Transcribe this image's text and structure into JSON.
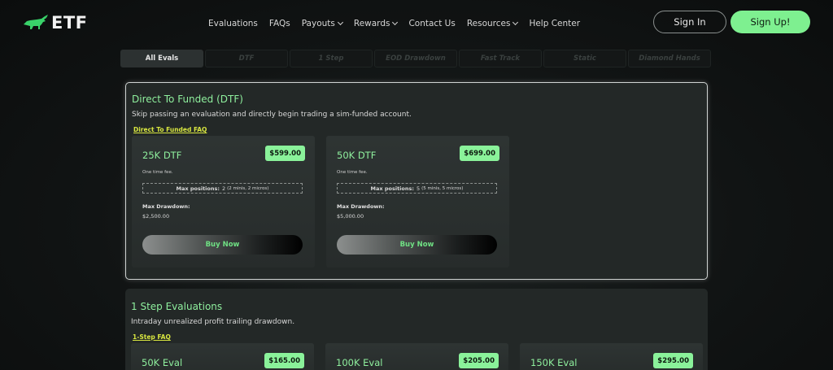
{
  "brand": {
    "logo_text": "ETF",
    "accent": "#8ff09e",
    "bull_color": "#39d36a"
  },
  "nav": [
    {
      "label": "Evaluations",
      "dropdown": false
    },
    {
      "label": "FAQs",
      "dropdown": false
    },
    {
      "label": "Payouts",
      "dropdown": true
    },
    {
      "label": "Rewards",
      "dropdown": true
    },
    {
      "label": "Contact Us",
      "dropdown": false
    },
    {
      "label": "Resources",
      "dropdown": true
    },
    {
      "label": "Help Center",
      "dropdown": false
    }
  ],
  "auth": {
    "signin_label": "Sign In",
    "signup_label": "Sign Up!"
  },
  "tabs": [
    {
      "label": "All Evals",
      "active": true
    },
    {
      "label": "DTF",
      "active": false
    },
    {
      "label": "1 Step",
      "active": false
    },
    {
      "label": "EOD Drawdown",
      "active": false
    },
    {
      "label": "Fast Track",
      "active": false
    },
    {
      "label": "Static",
      "active": false
    },
    {
      "label": "Diamond Hands",
      "active": false
    }
  ],
  "sections": {
    "dtf": {
      "title": "Direct To Funded (DTF)",
      "description": "Skip passing an evaluation and directly begin trading a sim-funded account.",
      "faq_link": "Direct To Funded FAQ",
      "cards": [
        {
          "name": "25K DTF",
          "price": "$599.00",
          "fee": "One time fee.",
          "max_positions_label": "Max positions:",
          "max_positions_value": "2",
          "max_positions_detail": "(2 minis, 2 micros)",
          "drawdown_label": "Max Drawdown:",
          "drawdown_value": "$2,500.00",
          "button": "Buy Now"
        },
        {
          "name": "50K DTF",
          "price": "$699.00",
          "fee": "One time fee.",
          "max_positions_label": "Max positions:",
          "max_positions_value": "5",
          "max_positions_detail": "(5 minis, 5 micros)",
          "drawdown_label": "Max Drawdown:",
          "drawdown_value": "$5,000.00",
          "button": "Buy Now"
        }
      ]
    },
    "one_step": {
      "title": "1 Step Evaluations",
      "description": "Intraday unrealized profit trailing drawdown.",
      "faq_link": "1-Step FAQ",
      "cards": [
        {
          "name": "50K Eval",
          "price": "$165.00"
        },
        {
          "name": "100K Eval",
          "price": "$205.00"
        },
        {
          "name": "150K Eval",
          "price": "$295.00"
        }
      ]
    }
  }
}
